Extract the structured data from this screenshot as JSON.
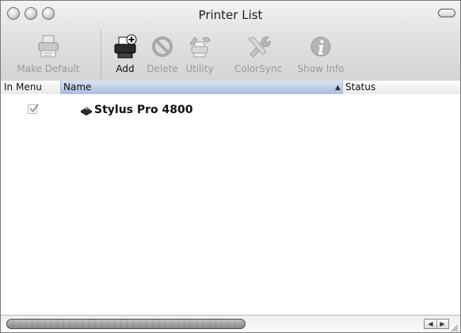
{
  "window": {
    "title": "Printer List"
  },
  "toolbar": {
    "items": [
      {
        "label": "Make Default",
        "icon": "printer-default-icon",
        "enabled": false
      },
      {
        "label": "Add",
        "icon": "add-printer-icon",
        "enabled": true
      },
      {
        "label": "Delete",
        "icon": "delete-icon",
        "enabled": false
      },
      {
        "label": "Utility",
        "icon": "utility-icon",
        "enabled": false
      },
      {
        "label": "ColorSync",
        "icon": "colorsync-icon",
        "enabled": false
      },
      {
        "label": "Show Info",
        "icon": "info-icon",
        "enabled": false
      }
    ]
  },
  "table": {
    "columns": [
      "In Menu",
      "Name",
      "Status"
    ],
    "sort_indicator": "▲",
    "rows": [
      {
        "in_menu": true,
        "name": "Stylus Pro 4800",
        "status": ""
      }
    ]
  },
  "colors": {
    "header_selected": "#a9bddb",
    "disabled_text": "#9a9a9a"
  }
}
